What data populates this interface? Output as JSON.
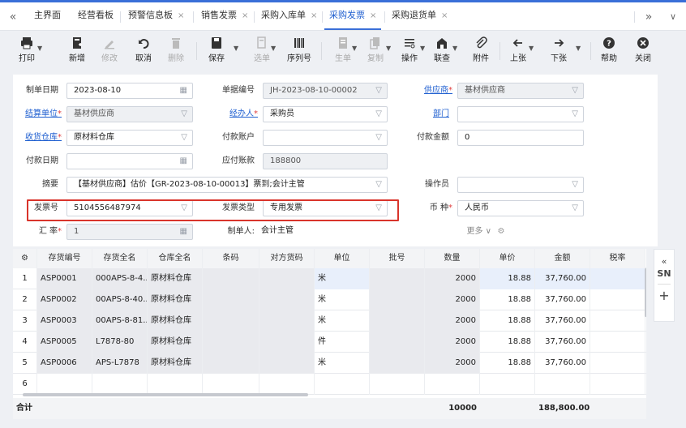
{
  "tabs": {
    "items": [
      {
        "label": "主界面",
        "closable": false
      },
      {
        "label": "经营看板",
        "closable": false
      },
      {
        "label": "预警信息板",
        "closable": true
      },
      {
        "label": "销售发票",
        "closable": true
      },
      {
        "label": "采购入库单",
        "closable": true
      },
      {
        "label": "采购发票",
        "closable": true,
        "active": true
      },
      {
        "label": "采购退货单",
        "closable": true
      }
    ],
    "nav_left": "«",
    "nav_right": "»",
    "nav_down": "∨",
    "close_glyph": "×"
  },
  "toolbar": {
    "print": "打印",
    "new": "新增",
    "modify": "修改",
    "cancel": "取消",
    "delete": "删除",
    "save": "保存",
    "select": "选单",
    "serial": "序列号",
    "generate": "生单",
    "copy": "复制",
    "operate": "操作",
    "audit": "联查",
    "attach": "附件",
    "prev": "上张",
    "next": "下张",
    "help": "帮助",
    "close": "关闭"
  },
  "form": {
    "doc_date_label": "制单日期",
    "doc_date": "2023-08-10",
    "doc_no_label": "单据编号",
    "doc_no": "JH-2023-08-10-00002",
    "supplier_label": "供应商",
    "supplier": "基材供应商",
    "settle_label": "结算单位",
    "settle": "基材供应商",
    "handler_label": "经办人",
    "handler": "采购员",
    "dept_label": "部门",
    "dept": "",
    "warehouse_label": "收货仓库",
    "warehouse": "原材料仓库",
    "pay_account_label": "付款账户",
    "pay_account": "",
    "pay_amount_label": "付款金额",
    "pay_amount": "0",
    "pay_date_label": "付款日期",
    "pay_date": "",
    "payable_label": "应付账款",
    "payable": "188800",
    "summary_label": "摘要",
    "summary": "【基材供应商】估价【GR-2023-08-10-00013】票到;会计主管",
    "operator_label": "操作员",
    "operator": "",
    "invoice_no_label": "发票号",
    "invoice_no": "5104556487974",
    "invoice_type_label": "发票类型",
    "invoice_type": "专用发票",
    "currency_label": "币 种",
    "currency": "人民币",
    "rate_label": "汇 率",
    "rate": "1",
    "creator_label": "制单人:",
    "creator": "会计主管",
    "more": "更多 ∨"
  },
  "grid": {
    "headers": [
      "存货编号",
      "存货全名",
      "仓库全名",
      "条码",
      "对方货码",
      "单位",
      "批号",
      "数量",
      "单价",
      "金额",
      "税率"
    ],
    "rows": [
      {
        "no": "1",
        "code": "ASP0001",
        "name": "000APS-8-4...",
        "wh": "原材料仓库",
        "unit": "米",
        "qty": "2000",
        "price": "18.88",
        "amount": "37,760.00"
      },
      {
        "no": "2",
        "code": "ASP0002",
        "name": "00APS-8-40...",
        "wh": "原材料仓库",
        "unit": "米",
        "qty": "2000",
        "price": "18.88",
        "amount": "37,760.00"
      },
      {
        "no": "3",
        "code": "ASP0003",
        "name": "00APS-8-81...",
        "wh": "原材料仓库",
        "unit": "米",
        "qty": "2000",
        "price": "18.88",
        "amount": "37,760.00"
      },
      {
        "no": "4",
        "code": "ASP0005",
        "name": "L7878-80",
        "wh": "原材料仓库",
        "unit": "件",
        "qty": "2000",
        "price": "18.88",
        "amount": "37,760.00"
      },
      {
        "no": "5",
        "code": "ASP0006",
        "name": "APS-L7878",
        "wh": "原材料仓库",
        "unit": "米",
        "qty": "2000",
        "price": "18.88",
        "amount": "37,760.00"
      },
      {
        "no": "6",
        "code": "",
        "name": "",
        "wh": "",
        "unit": "",
        "qty": "",
        "price": "",
        "amount": ""
      }
    ],
    "total_label": "合计",
    "total_qty": "10000",
    "total_amount": "188,800.00"
  },
  "side": {
    "collapse": "«",
    "sn": "SN",
    "add": "+"
  },
  "colors": {
    "accent": "#3a6fd8",
    "highlight": "#d9342b",
    "link": "#1f5fd0"
  }
}
